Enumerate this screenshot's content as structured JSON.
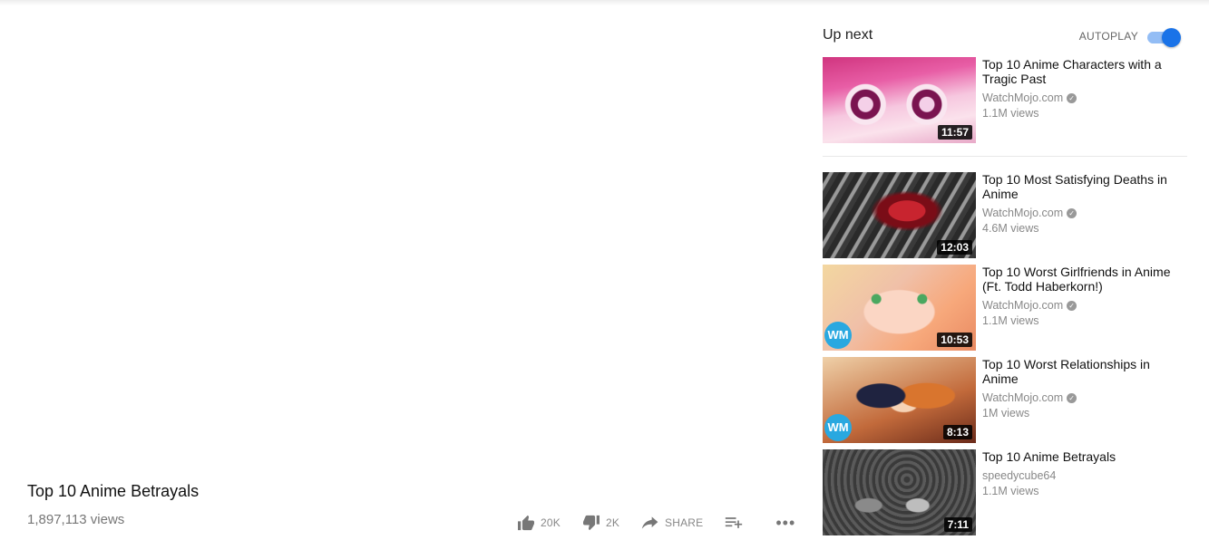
{
  "video": {
    "title": "Top 10 Anime Betrayals",
    "views": "1,897,113 views"
  },
  "actions": {
    "like_count": "20K",
    "dislike_count": "2K",
    "share_label": "SHARE",
    "more_label": "•••"
  },
  "sidebar": {
    "up_next_label": "Up next",
    "autoplay_label": "AUTOPLAY",
    "autoplay_on": true,
    "items": [
      {
        "title": "Top 10 Anime Characters with a Tragic Past",
        "channel": "WatchMojo.com",
        "verified": true,
        "views": "1.1M views",
        "duration": "11:57"
      },
      {
        "title": "Top 10 Most Satisfying Deaths in Anime",
        "channel": "WatchMojo.com",
        "verified": true,
        "views": "4.6M views",
        "duration": "12:03"
      },
      {
        "title": "Top 10 Worst Girlfriends in Anime (Ft. Todd Haberkorn!)",
        "channel": "WatchMojo.com",
        "verified": true,
        "views": "1.1M views",
        "duration": "10:53"
      },
      {
        "title": "Top 10 Worst Relationships in Anime",
        "channel": "WatchMojo.com",
        "verified": true,
        "views": "1M views",
        "duration": "8:13"
      },
      {
        "title": "Top 10 Anime Betrayals",
        "channel": "speedycube64",
        "verified": false,
        "views": "1.1M views",
        "duration": "7:11"
      }
    ]
  },
  "colors": {
    "accent": "#1a73e8",
    "watchmojo_logo": "#29a8e0"
  },
  "logo_text": "WM"
}
